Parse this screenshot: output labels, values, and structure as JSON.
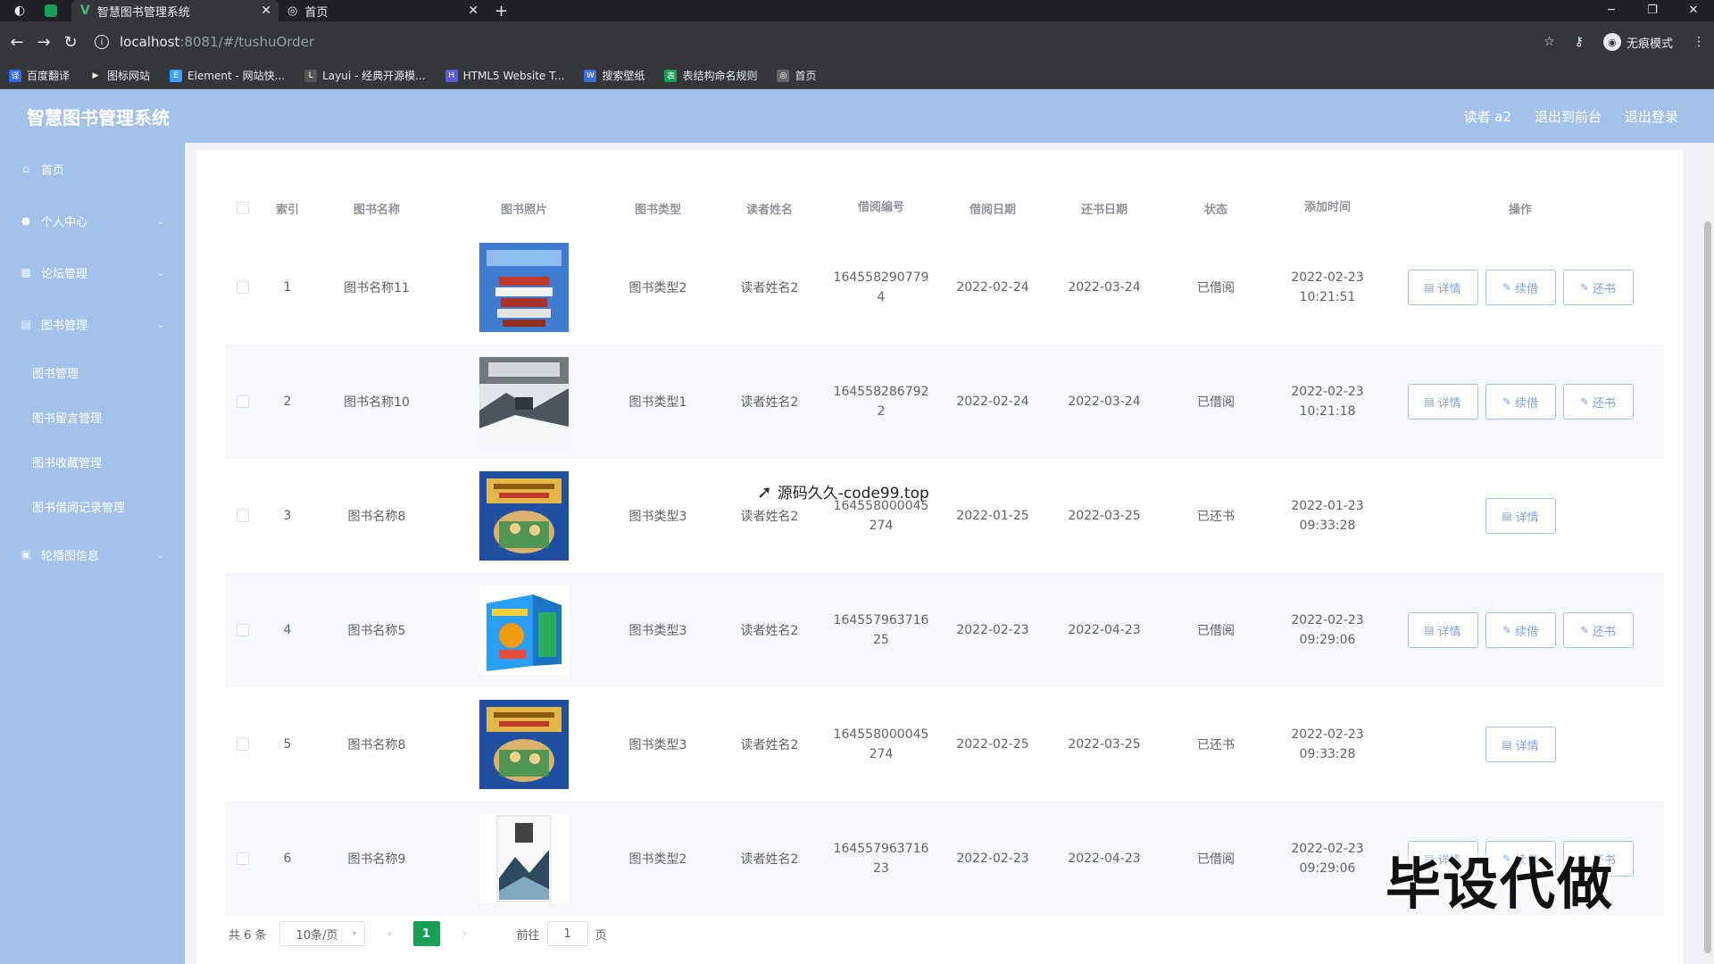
{
  "browser": {
    "tabs": [
      {
        "title": "智慧图书管理系统",
        "active": true
      },
      {
        "title": "首页",
        "active": false
      }
    ],
    "new_tab": "+",
    "url_host": "localhost",
    "url_path": ":8081/#/tushuOrder",
    "incognito_label": "无痕模式",
    "bookmarks": [
      {
        "label": "百度翻译",
        "color": "#2c6bf2",
        "icon_text": "译"
      },
      {
        "label": "图标网站",
        "color": "#333333",
        "icon_text": "▶"
      },
      {
        "label": "Element - 网站快...",
        "color": "#409eff",
        "icon_text": "E"
      },
      {
        "label": "Layui - 经典开源模...",
        "color": "#555555",
        "icon_text": "L"
      },
      {
        "label": "HTML5 Website T...",
        "color": "#5b5bd6",
        "icon_text": "H"
      },
      {
        "label": "搜索壁纸",
        "color": "#3b6fd8",
        "icon_text": "W"
      },
      {
        "label": "表结构命名规则",
        "color": "#18a058",
        "icon_text": "表"
      },
      {
        "label": "首页",
        "color": "#666666",
        "icon_text": "◎"
      }
    ]
  },
  "app": {
    "title": "智慧图书管理系统",
    "header_links": [
      "读者 a2",
      "退出到前台",
      "退出登录"
    ],
    "sidebar": {
      "menu": [
        {
          "label": "首页",
          "icon": "home-icon",
          "glyph": "⌂",
          "has_caret": false
        },
        {
          "label": "个人中心",
          "icon": "user-icon",
          "glyph": "●",
          "has_caret": true
        },
        {
          "label": "论坛管理",
          "icon": "forum-icon",
          "glyph": "▦",
          "has_caret": true
        },
        {
          "label": "图书管理",
          "icon": "book-icon",
          "glyph": "▤",
          "has_caret": true
        }
      ],
      "submenu": [
        "图书管理",
        "图书留言管理",
        "图书收藏管理",
        "图书借阅记录管理"
      ],
      "bottom_menu": {
        "label": "轮播图信息",
        "icon": "carousel-icon",
        "glyph": "▣"
      }
    }
  },
  "table": {
    "headers": [
      "索引",
      "图书名称",
      "图书照片",
      "图书类型",
      "读者姓名",
      "借阅编号",
      "借阅日期",
      "还书日期",
      "状态",
      "添加时间",
      "操作"
    ],
    "action_labels": {
      "detail": "详情",
      "renew": "续借",
      "return": "还书"
    },
    "rows": [
      {
        "index": "1",
        "name": "图书名称11",
        "cover": "cover-books-stack",
        "type": "图书类型2",
        "reader": "读者姓名2",
        "order_no": "1645582907794",
        "borrow_date": "2022-02-24",
        "return_date": "2022-03-24",
        "status": "已借阅",
        "added": "2022-02-23 10:21:51",
        "actions": [
          "detail",
          "renew",
          "return"
        ]
      },
      {
        "index": "2",
        "name": "图书名称10",
        "cover": "cover-winter-scene",
        "type": "图书类型1",
        "reader": "读者姓名2",
        "order_no": "1645582867922",
        "borrow_date": "2022-02-24",
        "return_date": "2022-03-24",
        "status": "已借阅",
        "added": "2022-02-23 10:21:18",
        "actions": [
          "detail",
          "renew",
          "return"
        ]
      },
      {
        "index": "3",
        "name": "图书名称8",
        "cover": "cover-romance-three-kingdoms",
        "type": "图书类型3",
        "reader": "读者姓名2",
        "order_no": "164558000045274",
        "borrow_date": "2022-01-25",
        "return_date": "2022-03-25",
        "status": "已还书",
        "added": "2022-01-23 09:33:28",
        "actions": [
          "detail"
        ]
      },
      {
        "index": "4",
        "name": "图书名称5",
        "cover": "cover-box-set",
        "type": "图书类型3",
        "reader": "读者姓名2",
        "order_no": "164557963716 25",
        "borrow_date": "2022-02-23",
        "return_date": "2022-04-23",
        "status": "已借阅",
        "added": "2022-02-23 09:29:06",
        "actions": [
          "detail",
          "renew",
          "return"
        ]
      },
      {
        "index": "5",
        "name": "图书名称8",
        "cover": "cover-romance-three-kingdoms",
        "type": "图书类型3",
        "reader": "读者姓名2",
        "order_no": "164558000045274",
        "borrow_date": "2022-02-25",
        "return_date": "2022-03-25",
        "status": "已还书",
        "added": "2022-02-23 09:33:28",
        "actions": [
          "detail"
        ]
      },
      {
        "index": "6",
        "name": "图书名称9",
        "cover": "cover-ink-landscape",
        "type": "图书类型2",
        "reader": "读者姓名2",
        "order_no": "164557963716 23",
        "borrow_date": "2022-02-23",
        "return_date": "2022-04-23",
        "status": "已借阅",
        "added": "2022-02-23 09:29:06",
        "actions": [
          "detail",
          "renew",
          "return"
        ]
      }
    ]
  },
  "pagination": {
    "total": "共 6 条",
    "page_size": "10条/页",
    "current": "1",
    "goto_label": "前往",
    "goto_value": "1",
    "page_suffix": "页"
  },
  "overlays": {
    "mid_watermark": "源码久久-code99.top",
    "big_watermark": "毕设代做"
  },
  "colors": {
    "primary": "#a3c2ea",
    "active_page": "#18a058"
  }
}
